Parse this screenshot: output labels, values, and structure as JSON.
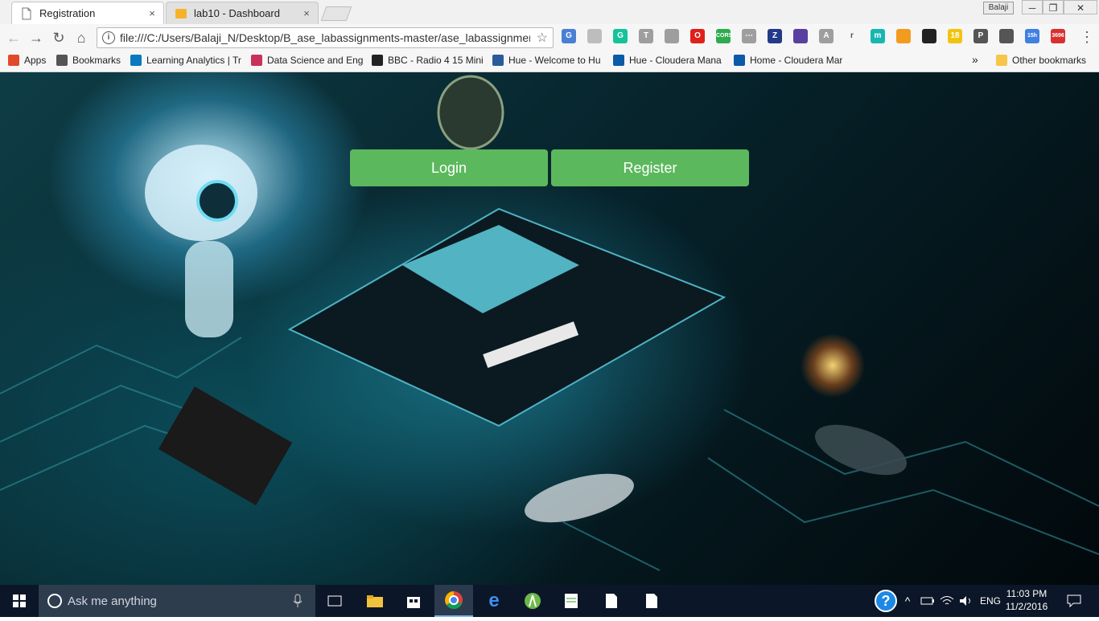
{
  "browser": {
    "tabs": [
      {
        "title": "Registration",
        "icon": "page-icon",
        "close": "×"
      },
      {
        "title": "lab10 - Dashboard",
        "icon": "cube-icon",
        "close": "×"
      }
    ],
    "profile_chip": "Balaji",
    "window_controls": {
      "minimize": "─",
      "restore": "❐",
      "close": "✕"
    },
    "nav": {
      "back": "←",
      "forward": "→",
      "reload": "↻",
      "home": "⌂"
    },
    "address": "file:///C:/Users/Balaji_N/Desktop/B_ase_labassignments-master/ase_labassignments",
    "info_glyph": "i",
    "bookmark_star": "☆",
    "extensions": [
      {
        "name": "google-translate-icon",
        "label": "G",
        "color": "#4a7fd4"
      },
      {
        "name": "doc-icon",
        "label": "",
        "color": "#bdbdbd"
      },
      {
        "name": "grammarly-icon",
        "label": "G",
        "color": "#15c39a"
      },
      {
        "name": "text-icon",
        "label": "T",
        "color": "#9e9e9e"
      },
      {
        "name": "drive-icon",
        "label": "",
        "color": "#9e9e9e"
      },
      {
        "name": "opera-icon",
        "label": "O",
        "color": "#e0201b"
      },
      {
        "name": "cors-icon",
        "label": "CORS",
        "color": "#2faa4f"
      },
      {
        "name": "dots-icon",
        "label": "⋯",
        "color": "#9e9e9e"
      },
      {
        "name": "zotero-icon",
        "label": "Z",
        "color": "#233a8a"
      },
      {
        "name": "puzzle-icon",
        "label": "",
        "color": "#5a3fa0"
      },
      {
        "name": "translate-icon",
        "label": "A",
        "color": "#9e9e9e"
      },
      {
        "name": "r-icon",
        "label": "r",
        "color": "#f6f6f6"
      },
      {
        "name": "m-icon",
        "label": "m",
        "color": "#17b7b0"
      },
      {
        "name": "wave-icon",
        "label": "",
        "color": "#f29c1f"
      },
      {
        "name": "color-wheel-icon",
        "label": "",
        "color": "#222222"
      },
      {
        "name": "weather-icon",
        "label": "18",
        "color": "#f2c40f"
      },
      {
        "name": "pocket-p-icon",
        "label": "P",
        "color": "#555555"
      },
      {
        "name": "bulb-icon",
        "label": "",
        "color": "#555555"
      },
      {
        "name": "calendar-icon",
        "label": "15h",
        "color": "#3f80e0"
      },
      {
        "name": "gmail-icon",
        "label": "3696",
        "color": "#d8302f"
      }
    ],
    "menu": "⋮",
    "bookmarks": [
      {
        "label": "Apps",
        "icon": "apps-grid-icon",
        "color": "#e04a2a"
      },
      {
        "label": "Bookmarks",
        "icon": "star-icon",
        "color": "#555555"
      },
      {
        "label": "Learning Analytics | Tr",
        "icon": "trello-icon",
        "color": "#0a79bf"
      },
      {
        "label": "Data Science and Eng",
        "icon": "edx-icon",
        "color": "#c8325a"
      },
      {
        "label": "BBC - Radio 4 15 Mini",
        "icon": "bbc-icon",
        "color": "#222222"
      },
      {
        "label": "Hue - Welcome to Hu",
        "icon": "hue-icon",
        "color": "#2a5a9a"
      },
      {
        "label": "Hue - Cloudera Mana",
        "icon": "cloudera-icon",
        "color": "#0a5aa8"
      },
      {
        "label": "Home - Cloudera Mar",
        "icon": "cloudera-icon",
        "color": "#0a5aa8"
      }
    ],
    "overflow": "»",
    "other_bookmarks": "Other bookmarks"
  },
  "page": {
    "login_label": "Login",
    "register_label": "Register",
    "button_color": "#5cb85c"
  },
  "taskbar": {
    "search_placeholder": "Ask me anything",
    "apps": [
      "task-view-icon",
      "file-explorer-icon",
      "store-icon",
      "chrome-icon",
      "edge-icon",
      "android-studio-icon",
      "notepad-icon",
      "file-icon",
      "file-icon"
    ],
    "tray": {
      "help": "?",
      "chevron": "^",
      "language": "ENG"
    },
    "time": "11:03 PM",
    "date": "11/2/2016"
  }
}
